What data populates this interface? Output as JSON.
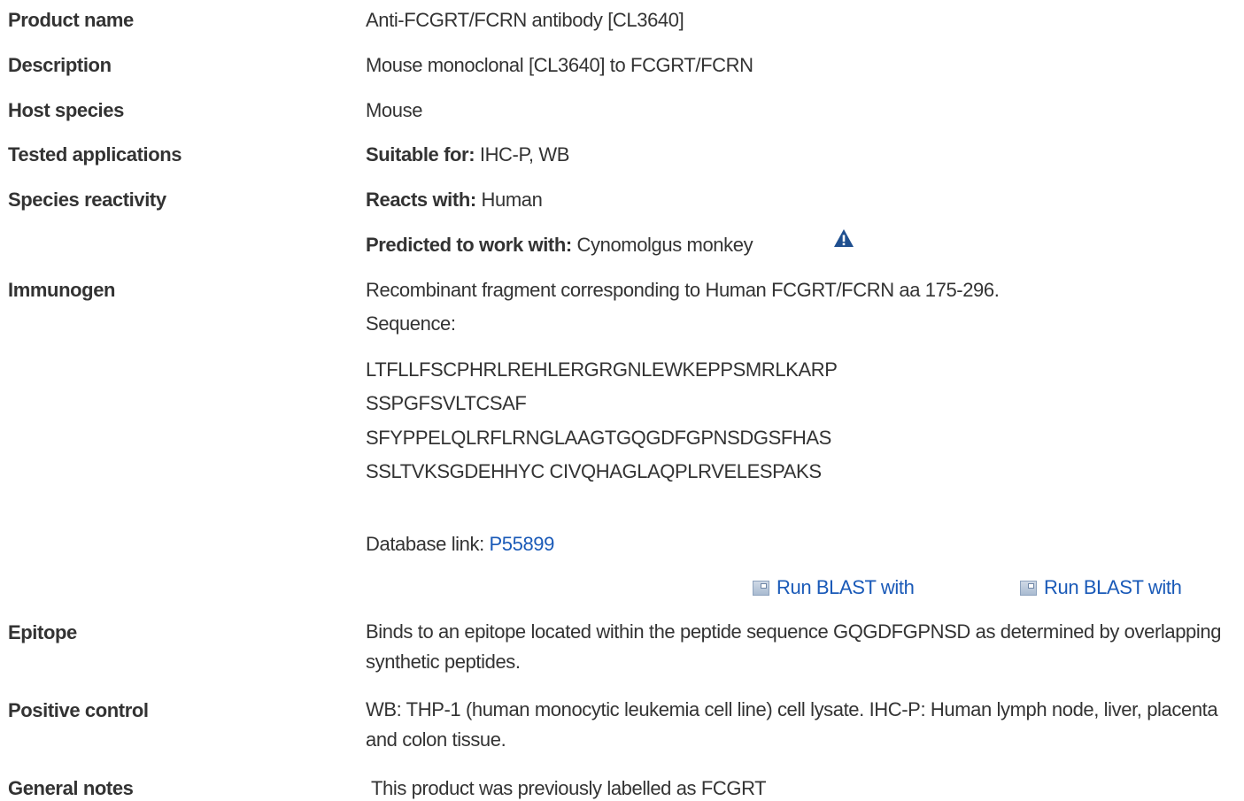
{
  "rows": {
    "product_name": {
      "label": "Product name",
      "value": "Anti-FCGRT/FCRN antibody [CL3640]"
    },
    "description": {
      "label": "Description",
      "value": "Mouse monoclonal [CL3640] to FCGRT/FCRN"
    },
    "host_species": {
      "label": "Host species",
      "value": "Mouse"
    },
    "tested_applications": {
      "label": "Tested applications",
      "prefix": "Suitable for:",
      "value": " IHC-P, WB"
    },
    "species_reactivity": {
      "label": "Species reactivity",
      "reacts_prefix": "Reacts with:",
      "reacts_value": " Human",
      "predicted_prefix": "Predicted to work with:",
      "predicted_value": " Cynomolgus monkey",
      "warning_icon": "warning-triangle-icon"
    },
    "immunogen": {
      "label": "Immunogen",
      "text": "Recombinant fragment corresponding to Human FCGRT/FCRN aa 175-296.",
      "sequence_label": "Sequence:",
      "sequence_lines": [
        "LTFLLFSCPHRLREHLERGRGNLEWKEPPSMRLKARP",
        "SSPGFSVLTCSAF",
        "SFYPPELQLRFLRNGLAAGTGQGDFGPNSDGSFHAS",
        "SSLTVKSGDEHHYC CIVQHAGLAQPLRVELESPAKS"
      ],
      "database_label": "Database link: ",
      "database_link": "P55899",
      "blast_links": [
        "Run BLAST with",
        "Run BLAST with"
      ],
      "blast_icon": "external-link-icon"
    },
    "epitope": {
      "label": "Epitope",
      "value": "Binds to an epitope located within the peptide sequence GQGDFGPNSD as determined by overlapping synthetic peptides."
    },
    "positive_control": {
      "label": "Positive control",
      "value": "WB: THP-1 (human monocytic leukemia cell line) cell lysate. IHC-P: Human lymph node, liver, placenta and colon tissue."
    },
    "general_notes": {
      "label": "General notes",
      "value": "This product was previously labelled as FCGRT"
    }
  },
  "colors": {
    "link": "#1a5ab8",
    "warning": "#1f4f8f",
    "text": "#333333"
  }
}
